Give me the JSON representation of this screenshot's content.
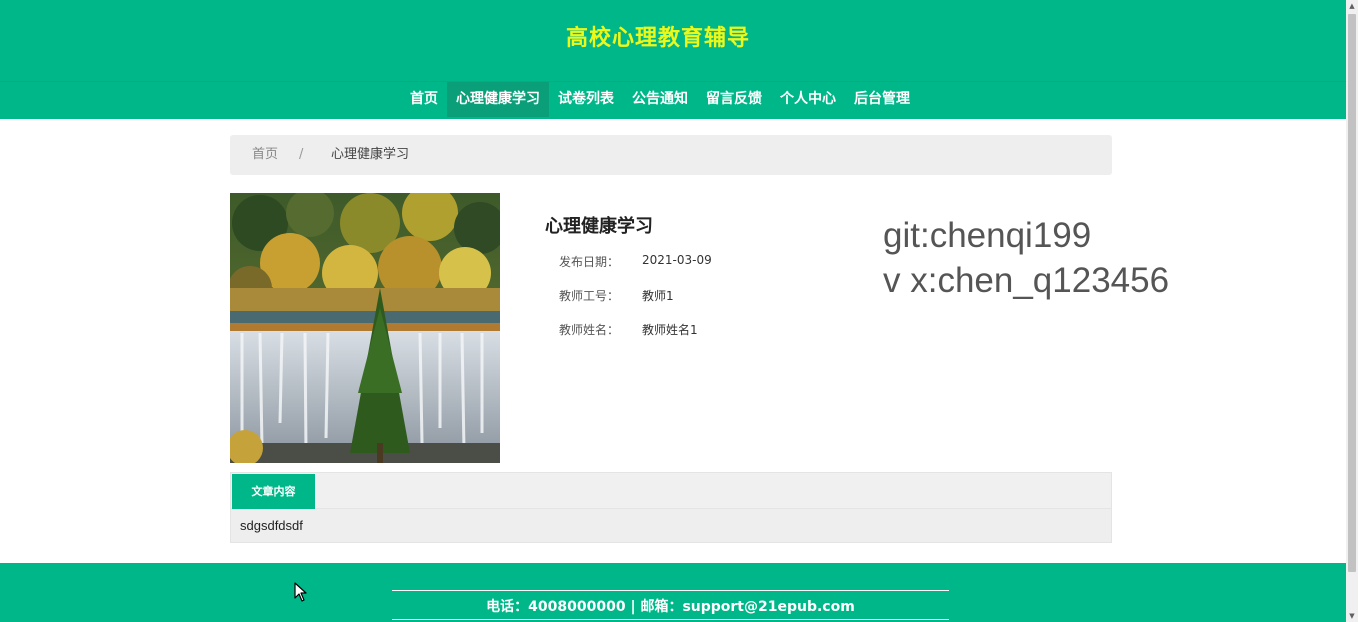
{
  "header": {
    "title": "高校心理教育辅导"
  },
  "nav": {
    "items": [
      {
        "label": "首页"
      },
      {
        "label": "心理健康学习",
        "active": true
      },
      {
        "label": "试卷列表"
      },
      {
        "label": "公告通知"
      },
      {
        "label": "留言反馈"
      },
      {
        "label": "个人中心"
      },
      {
        "label": "后台管理"
      }
    ]
  },
  "breadcrumb": {
    "home": "首页",
    "separator": "/",
    "current": "心理健康学习"
  },
  "detail": {
    "title": "心理健康学习",
    "fields": [
      {
        "label": "发布日期：",
        "value": "2021-03-09"
      },
      {
        "label": "教师工号：",
        "value": "教师1"
      },
      {
        "label": "教师姓名：",
        "value": "教师姓名1"
      }
    ]
  },
  "watermark": {
    "line1": "git:chenqi199",
    "line2": "v x:chen_q123456"
  },
  "tabs": {
    "active_label": "文章内容"
  },
  "content": {
    "text": "sdgsdfdsdf"
  },
  "footer": {
    "contact": "电话：4008000000 | 邮箱：support@21epub.com"
  },
  "colors": {
    "primary": "#00b789",
    "title": "#ecf81a",
    "nav_active": "#0a9f78"
  },
  "icons": {
    "cursor": "mouse-pointer-icon",
    "photo": "waterfall-landscape-image"
  }
}
